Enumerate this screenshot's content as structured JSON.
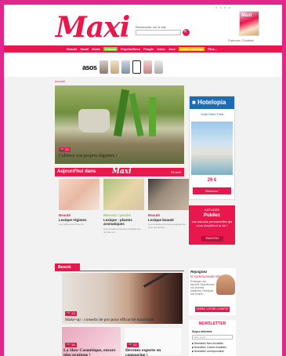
{
  "header": {
    "logo": "Maxi",
    "search_label": "Rechercher sur le site",
    "search_placeholder": "",
    "magazine_title": "Maxi",
    "magazine_links": "S'abonner | Feuilleter"
  },
  "nav": {
    "items": [
      {
        "label": "Beauté",
        "style": "normal"
      },
      {
        "label": "Santé",
        "style": "normal"
      },
      {
        "label": "Mode",
        "style": "normal"
      },
      {
        "label": "Cuisine",
        "style": "green"
      },
      {
        "label": "Psycho/Sexo",
        "style": "normal"
      },
      {
        "label": "People",
        "style": "normal"
      },
      {
        "label": "Astro",
        "style": "normal"
      },
      {
        "label": "Jeux",
        "style": "normal"
      },
      {
        "label": "Soldes mariage",
        "style": "highlight"
      },
      {
        "label": "Plus...",
        "style": "normal"
      }
    ]
  },
  "ad_strip": {
    "brand": "asos"
  },
  "breadcrumb": "Accueil",
  "hero": {
    "count": "23",
    "caption": "Cultivez vos propres légumes !"
  },
  "hotel_ad": {
    "brand": "Hotelopia",
    "hotel_name": "Suite Hotel Tirila",
    "price": "29 €",
    "button": "Réserver"
  },
  "astuces": {
    "label": "ASTUCES",
    "headline": "Publiez",
    "text": "vos astuces personnelles qui vous simplifient la vie !",
    "button": "ENVOYEZ"
  },
  "today": {
    "prefix": "Aujourd'hui dans",
    "brand": "Maxi",
    "date": "23 avril",
    "cards": [
      {
        "category": "Beauté",
        "title": "Lexique régimes",
        "desc": "Les rythmes du 9 au 15..."
      },
      {
        "category": "Minceur / perdre",
        "title": "Lexique : plantes aromatiques",
        "desc": "Les conseils et bonnes pratiques du monde vert..."
      },
      {
        "category": "Beauté",
        "title": "Lexique beauté",
        "desc": "Les conseils et bonnes pratiques de ceux qui aiment..."
      }
    ]
  },
  "beaute": {
    "tab": "Beauté",
    "count": "13",
    "caption": "Make-up : conseils de pro pour efficacité maximale",
    "small_cards": [
      {
        "count": "16",
        "title": "La Slow Cosmétique, encore plus pratique !"
      },
      {
        "count": "22",
        "title": "Devenez experte en contouring !"
      }
    ]
  },
  "community": {
    "line1": "Rejoignez",
    "line2": "la communauté Maxi",
    "text": "Échangez vos astuces, Sélectionnez vos recettes préférées, Participez aux forums...",
    "button": "CRÉEZ VOTRE COMPTE"
  },
  "newsletter": {
    "title": "NEWSLETTER",
    "label": "Soyez informée",
    "input_placeholder": "Votre email",
    "options": [
      "Newsletter Maxi Actualités",
      "Newsletter Cuisine Actualités",
      "Newsletter correspondante"
    ]
  },
  "colors": {
    "brand": "#e8174c",
    "frame": "#e0288c",
    "green": "#8cc63f",
    "highlight": "#f7b500",
    "hotel": "#1b6bb5"
  }
}
